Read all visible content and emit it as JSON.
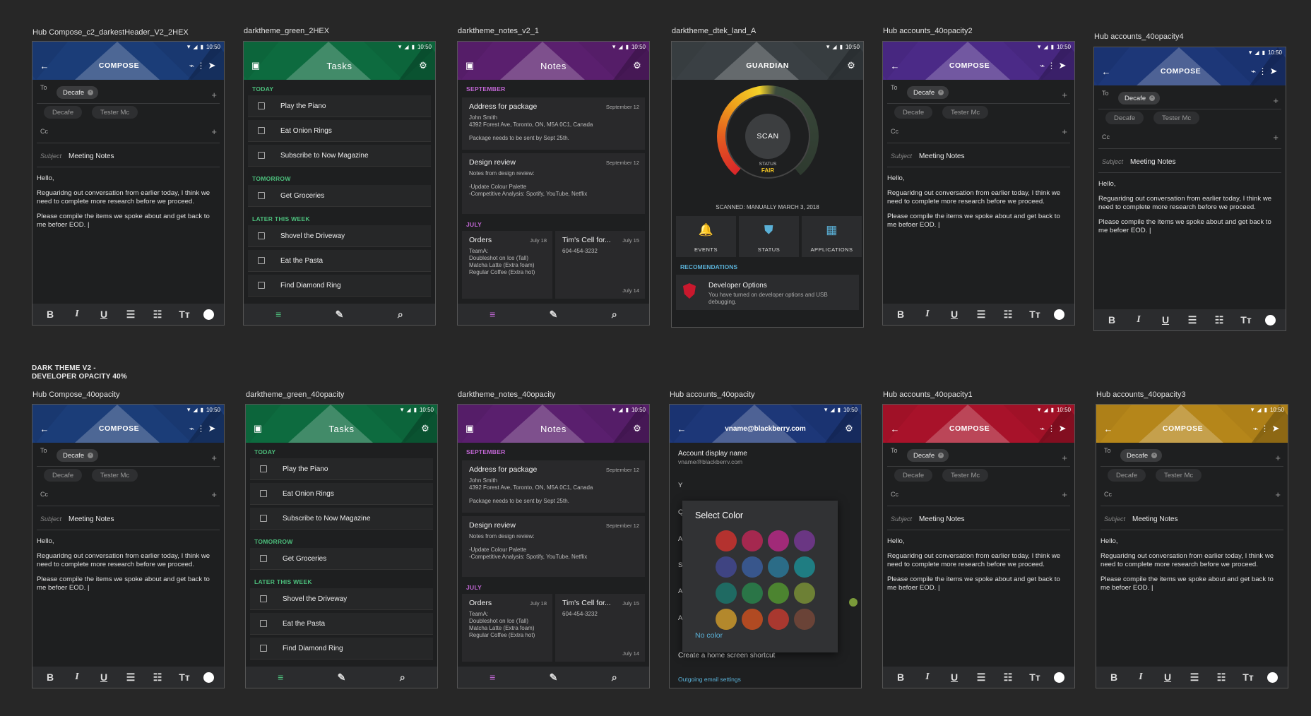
{
  "section_label_line1": "DARK THEME V2 -",
  "section_label_line2": "DEVELOPER OPACITY 40%",
  "statusbar_time": "10:50",
  "compose": {
    "title": "COMPOSE",
    "to_label": "To",
    "to_chip": "Decafe",
    "suggest_1": "Decafe",
    "suggest_2": "Tester Mc",
    "cc_label": "Cc",
    "subject_label": "Subject",
    "subject_value": "Meeting Notes",
    "body_1": "Hello,",
    "body_2": "Reguaridng out conversation from earlier today, I think we need to complete more research before we proceed.",
    "body_3": "Please compile the items we spoke about and get back to me befoer EOD. |",
    "toolbar": [
      "B",
      "I",
      "U",
      "☰",
      "☷",
      "Tт"
    ]
  },
  "tasks": {
    "title": "Tasks",
    "today": "TODAY",
    "tomorrow": "TOMORROW",
    "later": "LATER THIS WEEK",
    "items_today": [
      "Play the Piano",
      "Eat Onion Rings",
      "Subscribe to Now Magazine"
    ],
    "items_tomorrow": [
      "Get Groceries"
    ],
    "items_later": [
      "Shovel the Driveway",
      "Eat the Pasta",
      "Find Diamond Ring"
    ]
  },
  "notes": {
    "title": "Notes",
    "sept": "SEPTEMBER",
    "july": "JULY",
    "n1_title": "Address for package",
    "n1_date": "September 12",
    "n1_l1": "John Smith",
    "n1_l2": "4392 Forest Ave, Toronto, ON, M5A 0C1, Canada",
    "n1_l3": "Package needs to be sent by Sept 25th.",
    "n2_title": "Design review",
    "n2_date": "September 12",
    "n2_l1": "Notes from design review:",
    "n2_l2": "-Update Colour Palette",
    "n2_l3": "-Competitive Analysis: Spotify, YouTube, Netflix",
    "n3_title": "Orders",
    "n3_date": "July 18",
    "n3_l1": "TeamA:",
    "n3_l2": "Doubleshot on Ice (Tall)",
    "n3_l3": "Matcha Latte (Extra foam)",
    "n3_l4": "Regular Coffee (Extra hot)",
    "n4_title": "Tim's Cell for...",
    "n4_date": "July 15",
    "n4_l1": "604-454-3232",
    "n4_date2": "July 14"
  },
  "guardian": {
    "title": "GUARDIAN",
    "scan": "SCAN",
    "status_label": "STATUS",
    "status_value": "FAIR",
    "scanned": "SCANNED: MANUALLY MARCH 3, 2018",
    "events": "EVENTS",
    "status": "STATUS",
    "applications": "APPLICATIONS",
    "recommendations": "RECOMENDATIONS",
    "rec_title": "Developer Options",
    "rec_text": "You have turned on developer options and USB debugging."
  },
  "accounts": {
    "email": "vname@blackberry.com",
    "display_name_label": "Account display name",
    "display_name_value": "vname@blackberry.com",
    "dialog_title": "Select Color",
    "no_color": "No color",
    "shortcut": "Create a home screen shortcut",
    "outgoing": "Outgoing email settings",
    "row_letters": [
      "Y",
      "Q",
      "A",
      "S",
      "A",
      "A"
    ],
    "swatch_colors": [
      "#b4322f",
      "#a5284f",
      "#a12a78",
      "#6a3683",
      "#3f4482",
      "#38568c",
      "#2b6c87",
      "#1f7d82",
      "#1f6a62",
      "#2a7547",
      "#4c8430",
      "#6d8035",
      "#b3882c",
      "#b14a22",
      "#a9382f",
      "#6a4337"
    ]
  },
  "artboards": [
    {
      "label": "Hub Compose_c2_darkestHeader_V2_2HEX",
      "type": "compose",
      "color": "#1b3d78",
      "dark": "#112a55"
    },
    {
      "label": "darktheme_green_2HEX",
      "type": "tasks",
      "color": "#0d6b3f",
      "dark": "#08532f",
      "accent": "#4cbf7c"
    },
    {
      "label": "darktheme_notes_v2_1",
      "type": "notes",
      "color": "#5a1f6e",
      "dark": "#441657",
      "accent": "#c166d4"
    },
    {
      "label": "darktheme_dtek_land_A",
      "type": "guardian",
      "color": "#3a4044",
      "dark": "#2c3134",
      "accent": "#5ab0d6"
    },
    {
      "label": "Hub accounts_40opacity2",
      "type": "compose",
      "color": "#4b2a87",
      "dark": "#391f69"
    },
    {
      "label": "Hub accounts_40opacity4",
      "type": "compose",
      "color": "#1d3778",
      "dark": "#142a5c"
    },
    {
      "label": "Hub Compose_40opacity",
      "type": "compose",
      "color": "#1b3d78",
      "dark": "#112a55"
    },
    {
      "label": "darktheme_green_40opacity",
      "type": "tasks",
      "color": "#0d6b3f",
      "dark": "#08532f",
      "accent": "#4cbf7c"
    },
    {
      "label": "darktheme_notes_40opacity",
      "type": "notes",
      "color": "#5a1f6e",
      "dark": "#441657",
      "accent": "#c166d4"
    },
    {
      "label": "Hub accounts_40opacity",
      "type": "accounts",
      "color": "#1d3778",
      "dark": "#142a5c",
      "accent": "#5ab0d6"
    },
    {
      "label": "Hub accounts_40opacity1",
      "type": "compose",
      "color": "#a8122a",
      "dark": "#860c1f"
    },
    {
      "label": "Hub accounts_40opacity3",
      "type": "compose",
      "color": "#b5861a",
      "dark": "#946c10"
    }
  ]
}
